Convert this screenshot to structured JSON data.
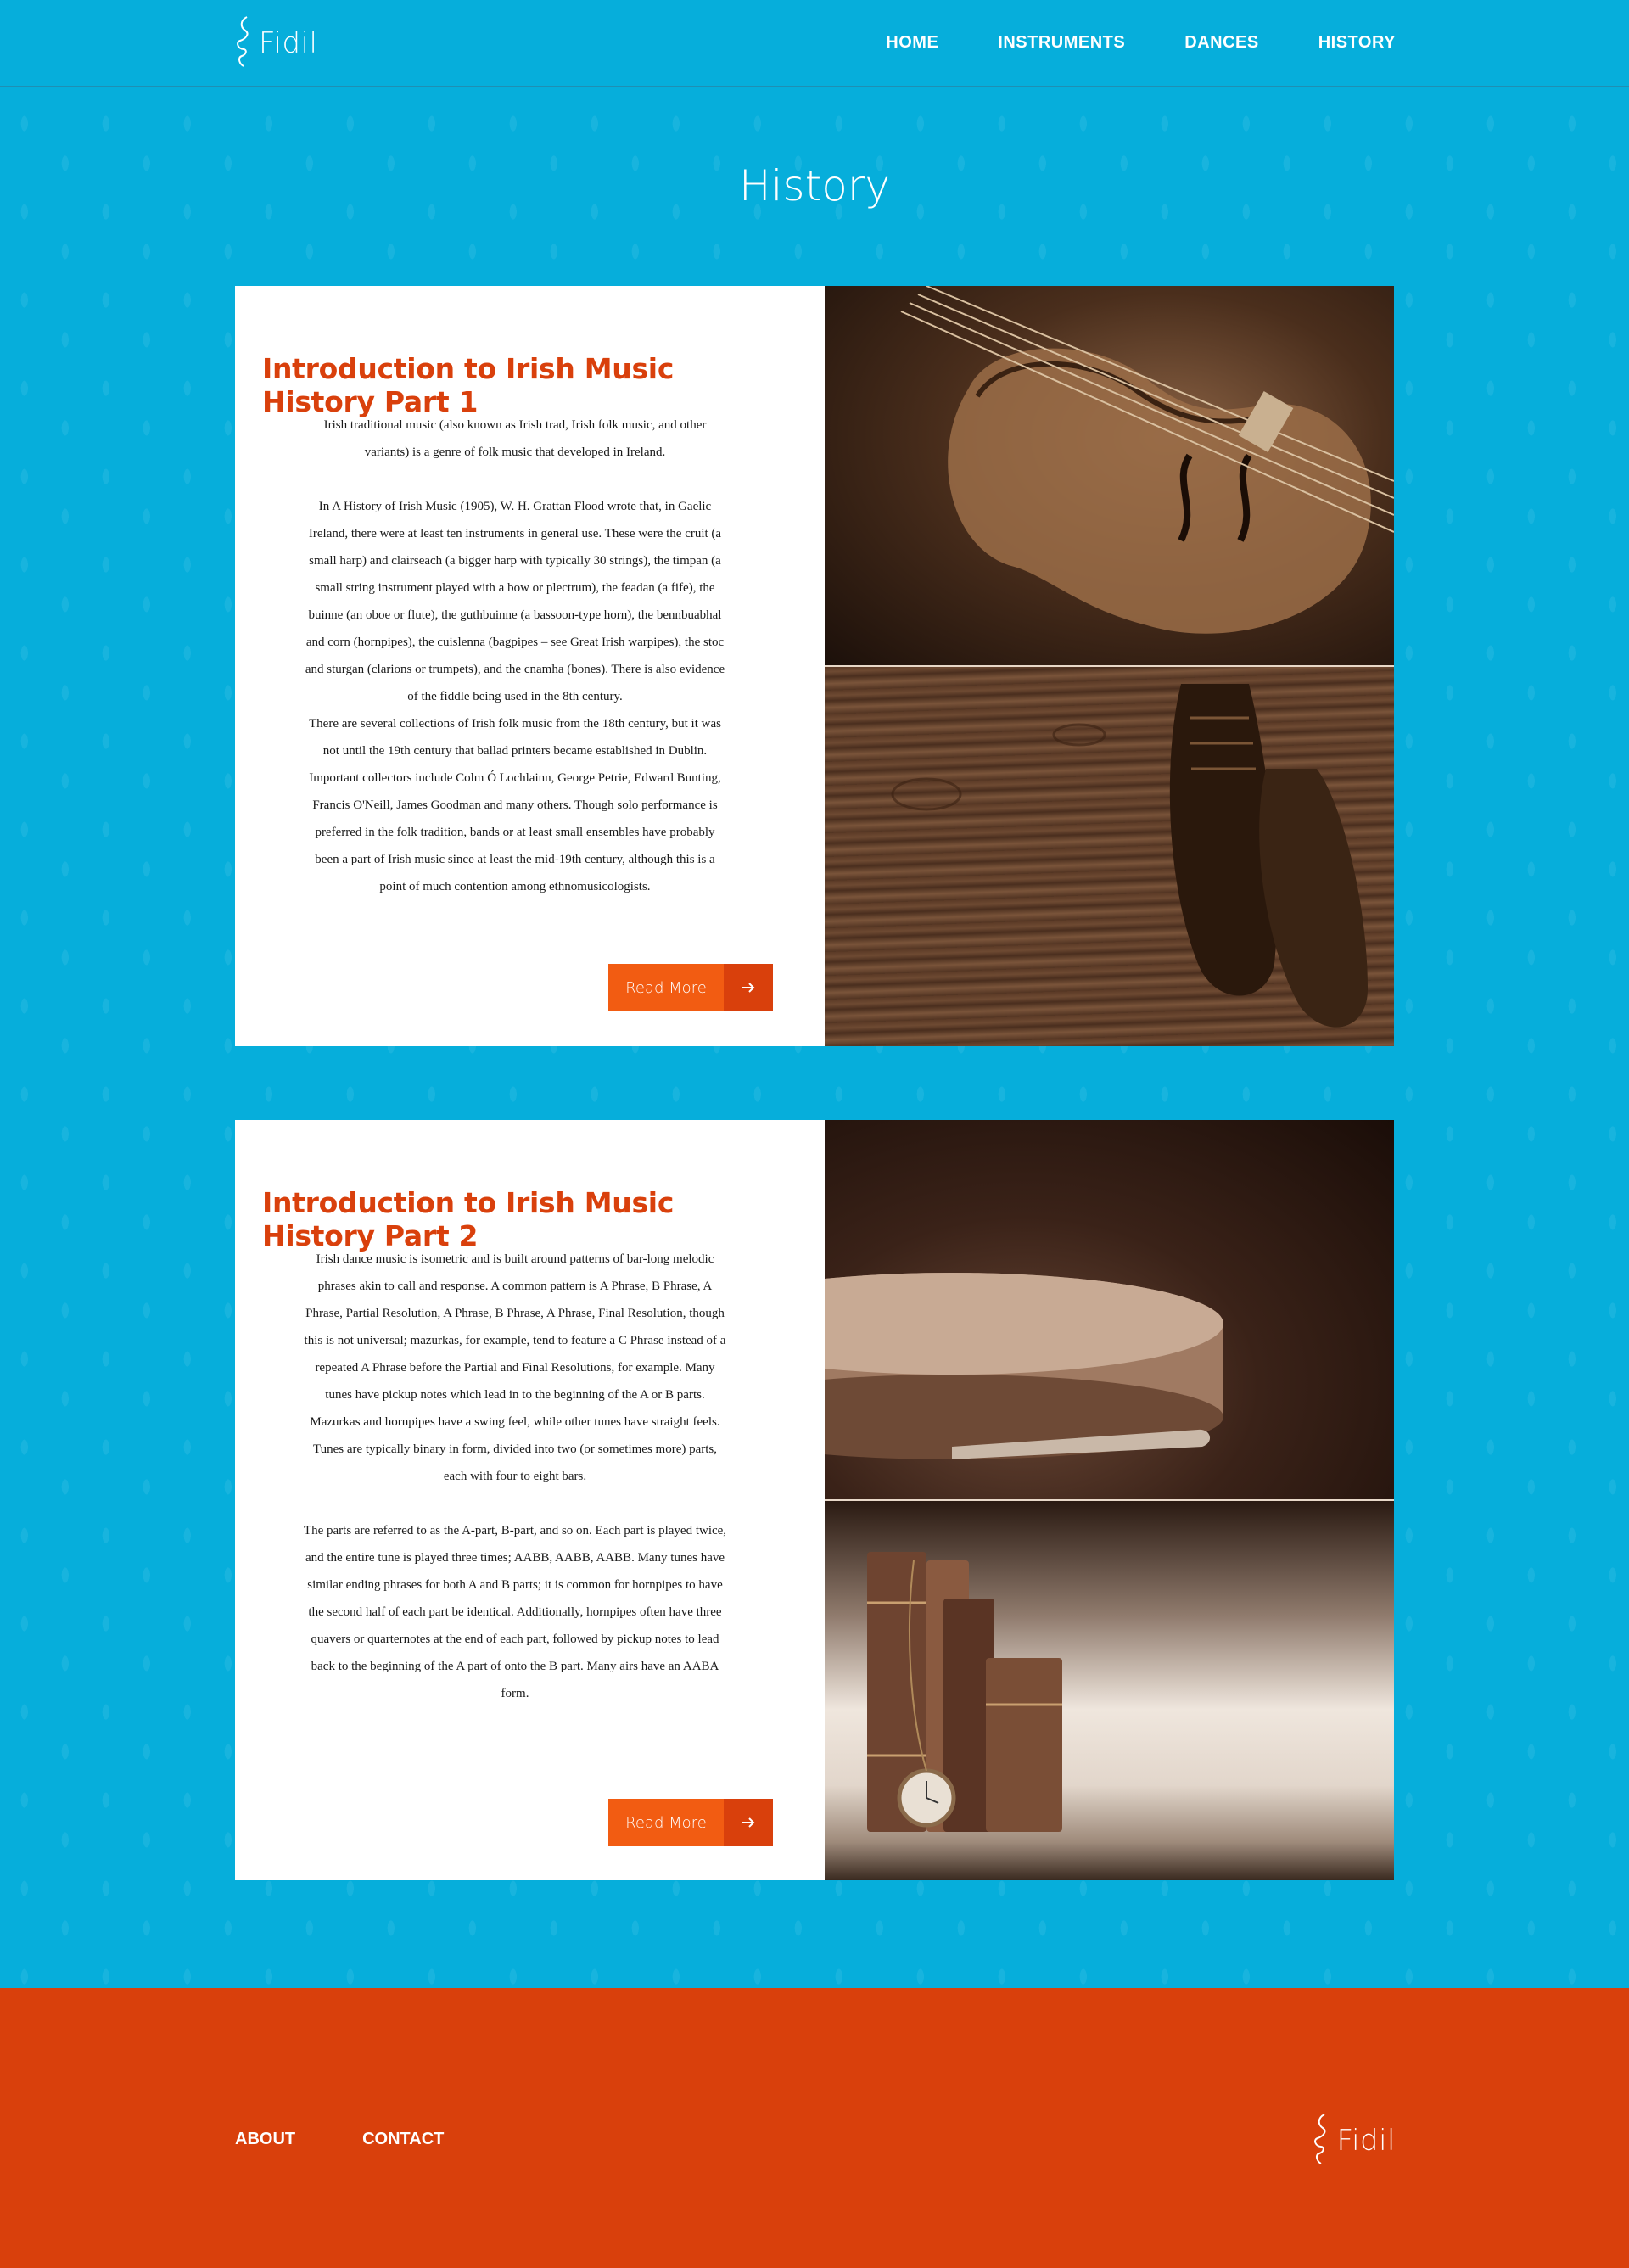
{
  "header": {
    "logo_text": "Fidil",
    "nav": [
      "HOME",
      "INSTRUMENTS",
      "DANCES",
      "HISTORY"
    ]
  },
  "page_title": "History",
  "articles": [
    {
      "title": "Introduction to Irish Music History Part 1",
      "paragraphs": [
        "Irish traditional music (also known as Irish trad, Irish folk music, and other variants) is a genre of folk music that developed in Ireland.",
        "In A History of Irish Music (1905), W. H. Grattan Flood wrote that, in Gaelic Ireland, there were at least ten instruments in general use. These were the cruit (a small harp) and clairseach (a bigger harp with typically 30 strings), the timpan (a small string instrument played with a bow or plectrum), the feadan (a fife), the buinne (an oboe or flute), the guthbuinne (a bassoon-type horn), the bennbuabhal and corn (hornpipes), the cuislenna (bagpipes – see Great Irish warpipes), the stoc and sturgan (clarions or trumpets), and the cnamha (bones). There is also evidence of the fiddle being used in the 8th century.",
        "There are several collections of Irish folk music from the 18th century, but it was not until the 19th century that ballad printers became established in Dublin. Important collectors include Colm Ó Lochlainn, George Petrie, Edward Bunting, Francis O'Neill, James Goodman and many others. Though solo performance is preferred in the folk tradition, bands or at least small ensembles have probably been a part of Irish music since at least the mid-19th century, although this is a point of much contention among ethnomusicologists."
      ],
      "button": "Read More"
    },
    {
      "title": "Introduction to Irish Music History Part 2",
      "paragraphs": [
        "Irish dance music is isometric and is built around patterns of bar-long melodic phrases akin to call and response. A common pattern is A Phrase, B Phrase, A Phrase, Partial Resolution, A Phrase, B Phrase, A Phrase, Final Resolution, though this is not universal; mazurkas, for example, tend to feature a C Phrase instead of a repeated A Phrase before the Partial and Final Resolutions, for example. Many tunes have pickup notes which lead in to the beginning of the A or B parts. Mazurkas and hornpipes have a swing feel, while other tunes have straight feels. Tunes are typically binary in form, divided into two (or sometimes more) parts, each with four to eight bars.",
        "The parts are referred to as the A-part, B-part, and so on. Each part is played twice, and the entire tune is played three times; AABB, AABB, AABB. Many tunes have similar ending phrases for both A and B parts; it is common for hornpipes to have the second half of each part be identical. Additionally, hornpipes often have three quavers or quarternotes at the end of each part, followed by pickup notes to lead back to the beginning of the A part of onto the B part. Many airs have an AABA form."
      ],
      "button": "Read More"
    }
  ],
  "footer": {
    "links": [
      "ABOUT",
      "CONTACT"
    ],
    "logo_text": "Fidil"
  },
  "colors": {
    "background": "#06aedb",
    "accent": "#d9400c",
    "button": "#f25c12"
  }
}
